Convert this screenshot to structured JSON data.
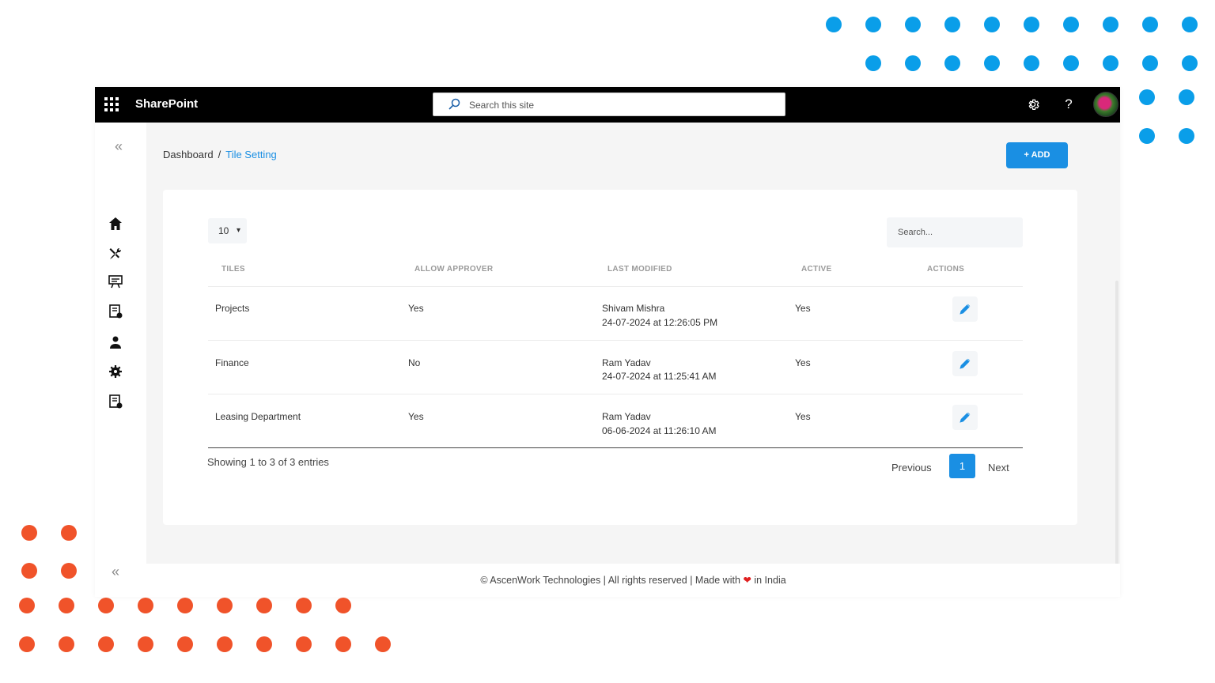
{
  "colors": {
    "accent": "#1a8fe3",
    "dots_blue": "#0a9ee9",
    "dots_red": "#f0532a",
    "topbar": "#000000"
  },
  "topbar": {
    "app_icon": "waffle-icon",
    "brand": "SharePoint",
    "search_placeholder": "Search this site",
    "settings_icon": "gear-icon",
    "help_label": "?",
    "avatar": "avatar"
  },
  "sidebar": {
    "collapse_label": "«",
    "items": [
      {
        "icon": "home-icon"
      },
      {
        "icon": "tools-icon"
      },
      {
        "icon": "presentation-icon"
      },
      {
        "icon": "document-settings-icon"
      },
      {
        "icon": "user-icon"
      },
      {
        "icon": "gear-icon"
      },
      {
        "icon": "document-settings-icon"
      }
    ]
  },
  "breadcrumb": {
    "home": "Dashboard",
    "separator": "/",
    "current": "Tile Setting"
  },
  "add_button": {
    "label": "+ ADD"
  },
  "table": {
    "page_size": "10",
    "search_placeholder": "Search...",
    "columns": [
      "TILES",
      "ALLOW APPROVER",
      "LAST MODIFIED",
      "ACTIVE",
      "ACTIONS"
    ],
    "rows": [
      {
        "tile": "Projects",
        "allow_approver": "Yes",
        "modified_by": "Shivam Mishra",
        "modified_at": "24-07-2024 at 12:26:05 PM",
        "active": "Yes",
        "action_icon": "pencil-icon"
      },
      {
        "tile": "Finance",
        "allow_approver": "No",
        "modified_by": "Ram Yadav",
        "modified_at": "24-07-2024 at 11:25:41 AM",
        "active": "Yes",
        "action_icon": "pencil-icon"
      },
      {
        "tile": "Leasing Department",
        "allow_approver": "Yes",
        "modified_by": "Ram Yadav",
        "modified_at": "06-06-2024 at 11:26:10 AM",
        "active": "Yes",
        "action_icon": "pencil-icon"
      }
    ],
    "showing": "Showing 1 to 3 of 3 entries",
    "pagination": {
      "previous": "Previous",
      "current": "1",
      "next": "Next"
    }
  },
  "footer": {
    "before": "© AscenWork Technologies | All rights reserved | Made with",
    "after": "in India"
  }
}
